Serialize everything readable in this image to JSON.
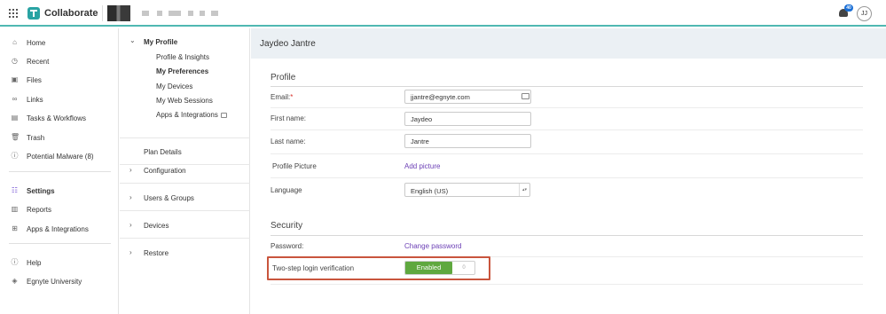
{
  "app": {
    "name": "Collaborate",
    "notification_count": "40",
    "user_initials": "JJ"
  },
  "sidebar": {
    "items": [
      {
        "label": "Home",
        "icon": "home-icon"
      },
      {
        "label": "Recent",
        "icon": "clock-icon"
      },
      {
        "label": "Files",
        "icon": "file-icon"
      },
      {
        "label": "Links",
        "icon": "link-icon"
      },
      {
        "label": "Tasks & Workflows",
        "icon": "tasks-icon"
      },
      {
        "label": "Trash",
        "icon": "trash-icon"
      },
      {
        "label": "Potential Malware (8)",
        "icon": "warning-icon"
      },
      {
        "label": "Settings",
        "icon": "settings-icon"
      },
      {
        "label": "Reports",
        "icon": "report-icon"
      },
      {
        "label": "Apps & Integrations",
        "icon": "apps-icon"
      },
      {
        "label": "Help",
        "icon": "help-icon"
      },
      {
        "label": "Egnyte University",
        "icon": "university-icon"
      }
    ]
  },
  "subnav": {
    "my_profile": {
      "label": "My Profile",
      "items": [
        "Profile & Insights",
        "My Preferences",
        "My Devices",
        "My Web Sessions",
        "Apps & Integrations"
      ]
    },
    "plan_details": "Plan Details",
    "sections": [
      "Configuration",
      "Users & Groups",
      "Devices",
      "Restore"
    ]
  },
  "main": {
    "title": "Jaydeo Jantre",
    "profile": {
      "heading": "Profile",
      "email_label": "Email:",
      "email_required": "*",
      "email_value": "jjantre@egnyte.com",
      "first_name_label": "First name:",
      "first_name_value": "Jaydeo",
      "last_name_label": "Last name:",
      "last_name_value": "Jantre",
      "picture_label": "Profile Picture",
      "picture_link": "Add picture",
      "language_label": "Language",
      "language_value": "English (US)"
    },
    "security": {
      "heading": "Security",
      "password_label": "Password:",
      "password_link": "Change password",
      "two_step_label": "Two-step login verification",
      "two_step_on": "Enabled",
      "two_step_off": "0",
      "two_step_enabled": true
    }
  },
  "colors": {
    "accent": "#4fb8b2",
    "link": "#6b3fb5",
    "toggle_on": "#5fa83f",
    "highlight": "#c9553d",
    "header_bg": "#ebf0f4"
  }
}
